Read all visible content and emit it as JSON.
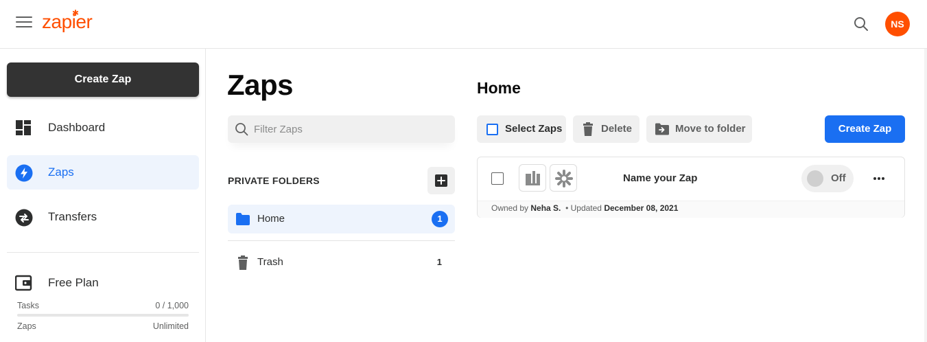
{
  "header": {
    "logo_text": "zapier",
    "avatar_initials": "NS",
    "colors": {
      "brand": "#ff4f00",
      "accent": "#1a6ff2"
    }
  },
  "sidebar": {
    "create_zap_label": "Create Zap",
    "items": [
      {
        "label": "Dashboard",
        "icon": "dashboard-icon",
        "active": false
      },
      {
        "label": "Zaps",
        "icon": "lightning-icon",
        "active": true
      },
      {
        "label": "Transfers",
        "icon": "transfer-arrows-icon",
        "active": false
      }
    ],
    "plan": {
      "label": "Free Plan",
      "tasks_label": "Tasks",
      "tasks_value": "0 / 1,000",
      "tasks_used_fraction": 0,
      "zaps_label": "Zaps",
      "zaps_value": "Unlimited"
    }
  },
  "folders": {
    "title": "Zaps",
    "filter_placeholder": "Filter Zaps",
    "section_heading": "PRIVATE FOLDERS",
    "items": [
      {
        "label": "Home",
        "count": "1",
        "icon": "folder-icon",
        "active": true
      },
      {
        "label": "Trash",
        "count": "1",
        "icon": "trash-icon",
        "active": false
      }
    ]
  },
  "main": {
    "title": "Home",
    "toolbar": {
      "select_label": "Select Zaps",
      "delete_label": "Delete",
      "move_label": "Move to folder",
      "create_label": "Create Zap"
    },
    "zaps": [
      {
        "name": "Name your Zap",
        "state": "Off",
        "owned_by_label": "Owned by",
        "owner": "Neha S.",
        "updated_label": "• Updated",
        "updated_date": "December 08, 2021",
        "apps": [
          "app-logo-icon",
          "asterisk-app-icon"
        ]
      }
    ]
  }
}
